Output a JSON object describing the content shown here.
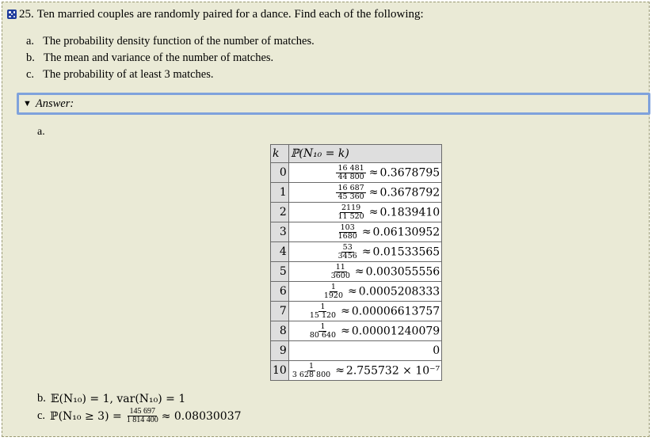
{
  "problem": {
    "number": "25.",
    "statement": "Ten married couples are randomly paired for a dance. Find each of the following:",
    "parts": [
      {
        "label": "a.",
        "text": "The probability density function of the number of matches."
      },
      {
        "label": "b.",
        "text": "The mean and variance of the number of matches."
      },
      {
        "label": "c.",
        "text": "The probability of at least 3 matches."
      }
    ]
  },
  "answer": {
    "toggle_label": "Answer:",
    "part_a_label": "a.",
    "table": {
      "col_k": "k",
      "col_p": "ℙ(N₁₀ = k)",
      "rows": [
        {
          "k": "0",
          "num": "16 481",
          "den": "44 800",
          "approx": "0.3678795"
        },
        {
          "k": "1",
          "num": "16 687",
          "den": "45 360",
          "approx": "0.3678792"
        },
        {
          "k": "2",
          "num": "2119",
          "den": "11 520",
          "approx": "0.1839410"
        },
        {
          "k": "3",
          "num": "103",
          "den": "1680",
          "approx": "0.06130952"
        },
        {
          "k": "4",
          "num": "53",
          "den": "3456",
          "approx": "0.01533565"
        },
        {
          "k": "5",
          "num": "11",
          "den": "3600",
          "approx": "0.003055556"
        },
        {
          "k": "6",
          "num": "1",
          "den": "1920",
          "approx": "0.0005208333"
        },
        {
          "k": "7",
          "num": "1",
          "den": "15 120",
          "approx": "0.00006613757"
        },
        {
          "k": "8",
          "num": "1",
          "den": "80 640",
          "approx": "0.00001240079"
        },
        {
          "k": "9",
          "num": "",
          "den": "",
          "approx": "0"
        },
        {
          "k": "10",
          "num": "1",
          "den": "3 628 800",
          "approx": "2.755732 × 10⁻⁷"
        }
      ]
    },
    "part_b": {
      "label": "b.",
      "text": "𝔼(N₁₀) = 1, var(N₁₀) = 1"
    },
    "part_c": {
      "label": "c.",
      "lhs": "ℙ(N₁₀ ≥ 3) =",
      "num": "145 697",
      "den": "1 814 400",
      "approx": "≈ 0.08030037"
    }
  }
}
